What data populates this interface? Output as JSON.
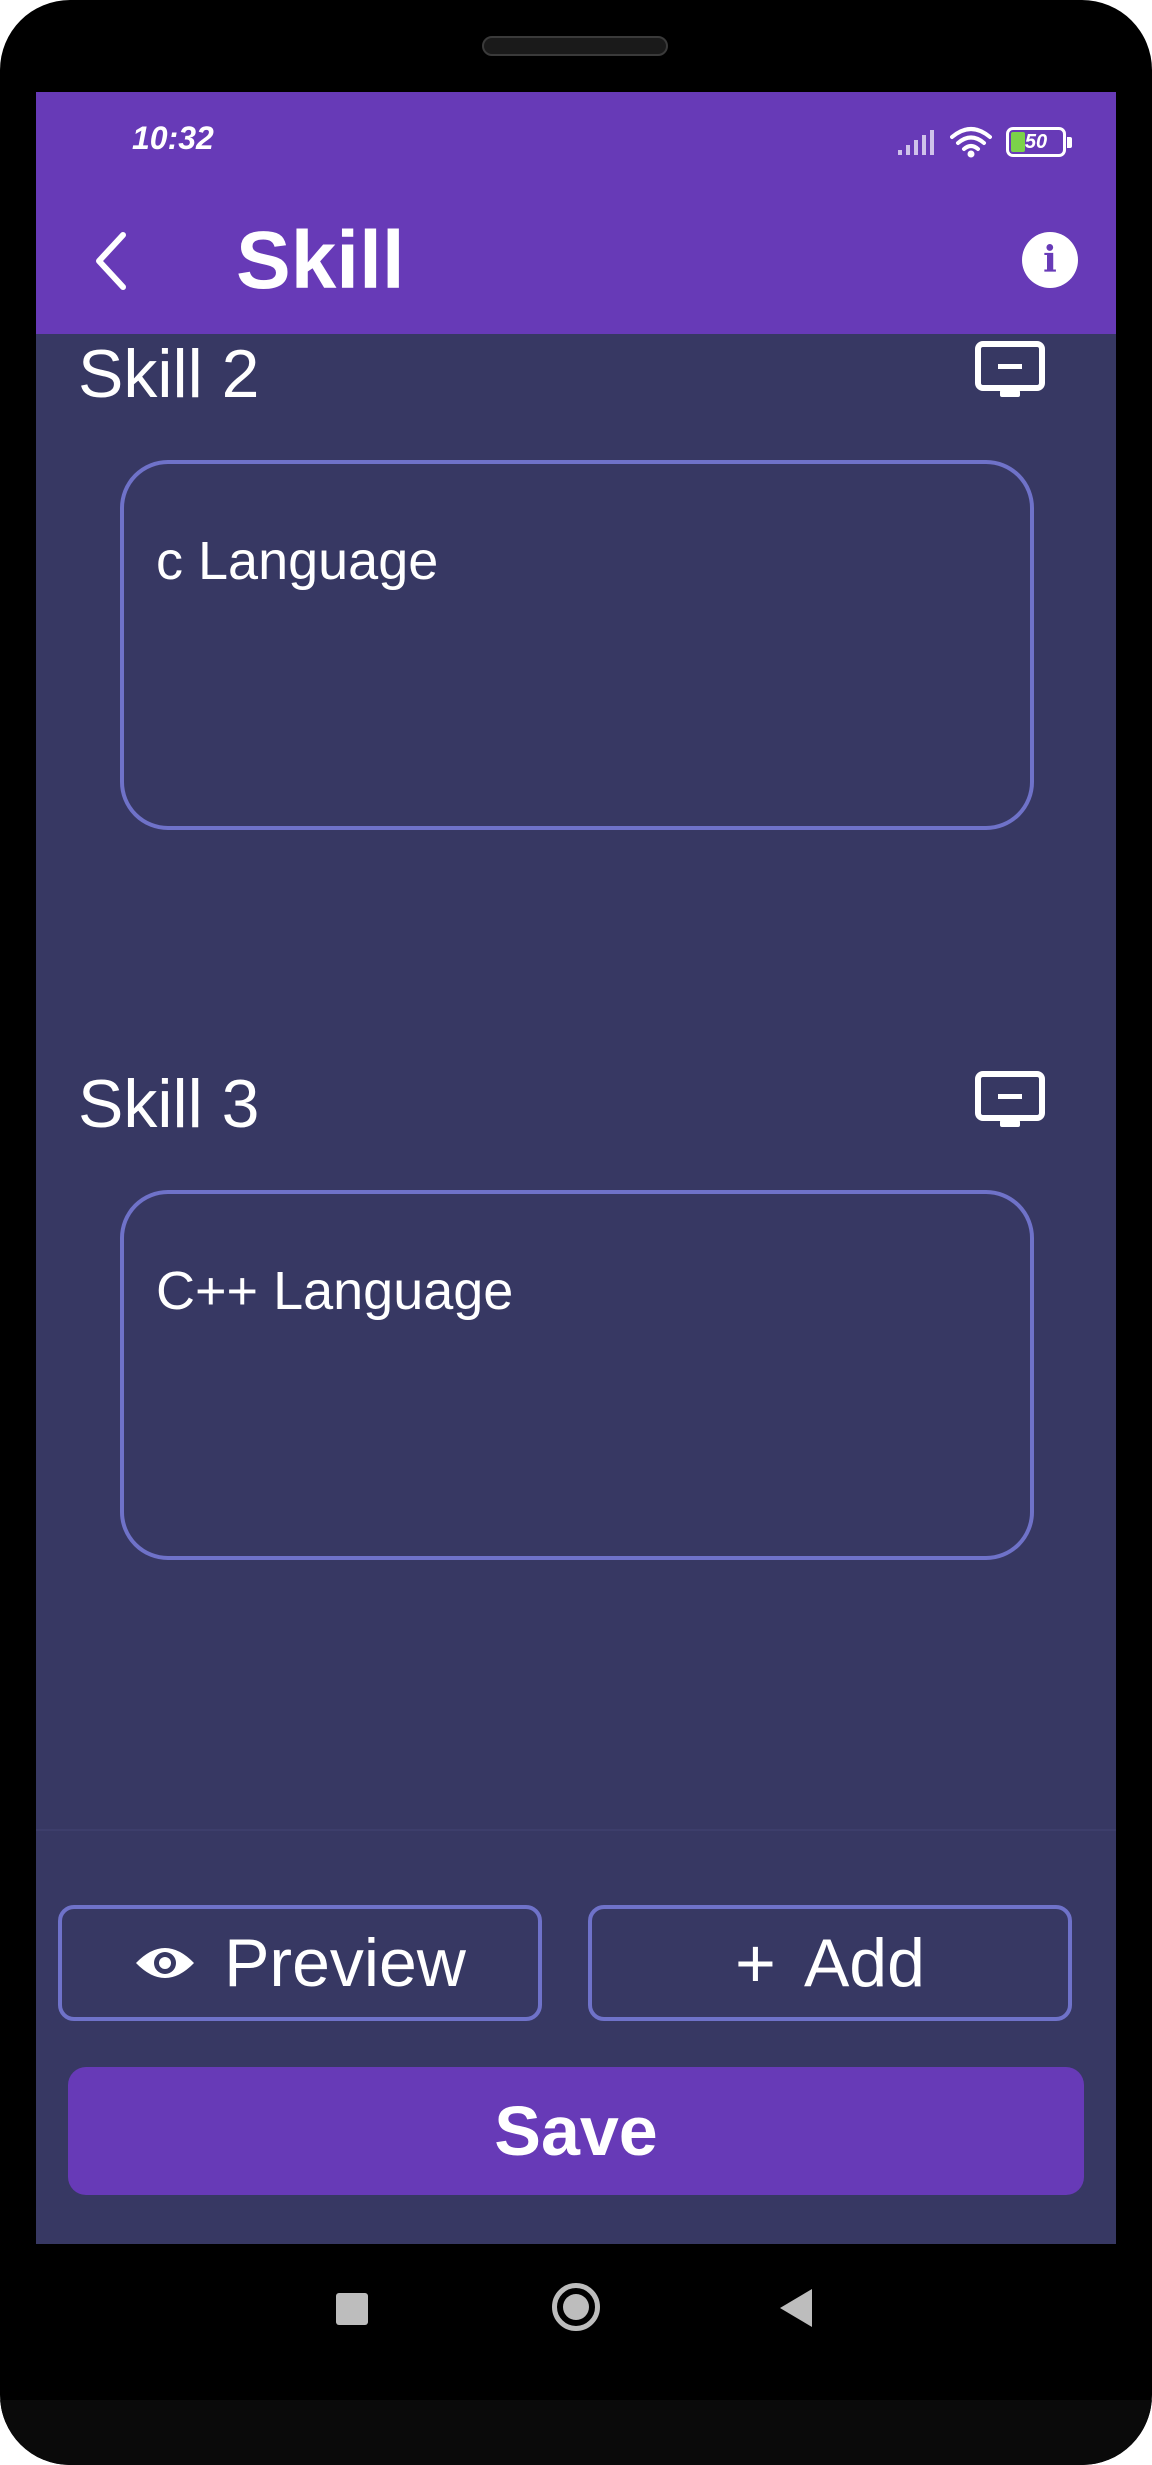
{
  "status_bar": {
    "time": "10:32",
    "battery_level": "50",
    "icons": [
      "signal-icon",
      "wifi-icon",
      "battery-icon"
    ]
  },
  "app_bar": {
    "title": "Skill",
    "back_icon": "chevron-left-icon",
    "info_icon": "info-icon",
    "info_glyph": "i"
  },
  "skills": [
    {
      "label": "Skill 2",
      "value": "c Language",
      "remove_icon": "remove-box-icon"
    },
    {
      "label": "Skill 3",
      "value": "C++ Language",
      "remove_icon": "remove-box-icon"
    }
  ],
  "actions": {
    "preview_label": "Preview",
    "preview_icon": "eye-icon",
    "add_label": "Add",
    "add_glyph": "+",
    "save_label": "Save"
  },
  "colors": {
    "primary": "#673ab7",
    "background": "#373863",
    "outline": "#6f72c9",
    "battery_fill": "#7bd24a"
  },
  "nav_bar": {
    "icons": [
      "recents-square-icon",
      "home-circle-icon",
      "back-triangle-icon"
    ]
  }
}
